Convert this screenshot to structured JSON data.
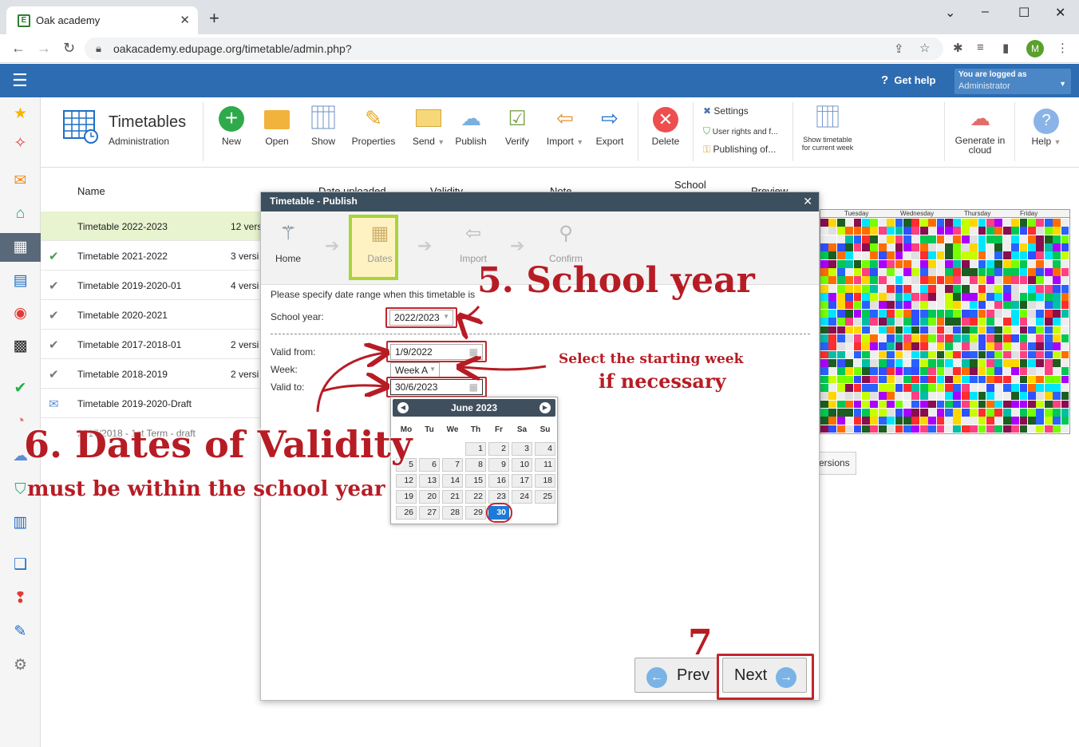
{
  "browser": {
    "tab_title": "Oak academy",
    "favicon": "E",
    "url": "oakacademy.edupage.org/timetable/admin.php?",
    "profile_initial": "M"
  },
  "appbar": {
    "get_help": "Get help",
    "user_line1": "You are logged as",
    "user_line2": "Administrator"
  },
  "ribbon": {
    "title": "Timetables",
    "subtitle": "Administration",
    "tools": {
      "new": "New",
      "open": "Open",
      "show": "Show",
      "properties": "Properties",
      "send": "Send",
      "publish": "Publish",
      "verify": "Verify",
      "import": "Import",
      "export": "Export",
      "delete": "Delete",
      "generate": "Generate in cloud",
      "help": "Help"
    },
    "settings": "Settings",
    "user_rights": "User rights and f...",
    "publishing_of": "Publishing of...",
    "show_current_week": "Show timetable for current week"
  },
  "list": {
    "columns": {
      "name": "Name",
      "date_uploaded": "Date uploaded",
      "validity": "Validity",
      "note": "Note",
      "school": "School",
      "preview": "Preview"
    },
    "rows": [
      {
        "name": "Timetable 2022-2023",
        "versions": "12 vers"
      },
      {
        "name": "Timetable 2021-2022",
        "versions": "3 versi"
      },
      {
        "name": "Timetable 2019-2020-01",
        "versions": "4 versi"
      },
      {
        "name": "Timetable 2020-2021",
        "versions": ""
      },
      {
        "name": "Timetable 2017-2018-01",
        "versions": "2 versi"
      },
      {
        "name": "Timetable 2018-2019",
        "versions": "2 versi"
      },
      {
        "name": "Timetable 2019-2020-Draft",
        "versions": ""
      },
      {
        "name": "2017/2018 - 1st Term - draft",
        "versions": ""
      }
    ],
    "preview_days": [
      "Tuesday",
      "Wednesday",
      "Thursday",
      "Friday"
    ],
    "versions_button": "ersions"
  },
  "dialog": {
    "title": "Timetable - Publish",
    "steps": {
      "home": "Home",
      "dates": "Dates",
      "import": "Import",
      "confirm": "Confirm"
    },
    "instruction": "Please specify date range when this timetable is",
    "school_year_label": "School year:",
    "school_year_value": "2022/2023",
    "valid_from_label": "Valid from:",
    "valid_from_value": "1/9/2022",
    "week_label": "Week:",
    "week_value": "Week A",
    "valid_to_label": "Valid to:",
    "valid_to_value": "30/6/2023",
    "calendar": {
      "month": "June 2023",
      "dow": [
        "Mo",
        "Tu",
        "We",
        "Th",
        "Fr",
        "Sa",
        "Su"
      ],
      "weeks": [
        [
          "",
          "",
          "",
          "1",
          "2",
          "3",
          "4"
        ],
        [
          "5",
          "6",
          "7",
          "8",
          "9",
          "10",
          "11"
        ],
        [
          "12",
          "13",
          "14",
          "15",
          "16",
          "17",
          "18"
        ],
        [
          "19",
          "20",
          "21",
          "22",
          "23",
          "24",
          "25"
        ],
        [
          "26",
          "27",
          "28",
          "29",
          "30",
          "",
          ""
        ]
      ],
      "selected_day": "30"
    },
    "prev": "Prev",
    "next": "Next"
  },
  "annotations": {
    "school_year": "5. School year",
    "starting_week_1": "Select the starting week",
    "starting_week_2": "if necessary",
    "dates_validity": "6. Dates of Validity",
    "within_year": "must be within the school year",
    "step7": "7"
  },
  "colors": {
    "accent": "#2d6cb0",
    "annotation": "#b71c25",
    "dates_highlight": "#a9d33a",
    "selected_day": "#1d7bd8"
  }
}
